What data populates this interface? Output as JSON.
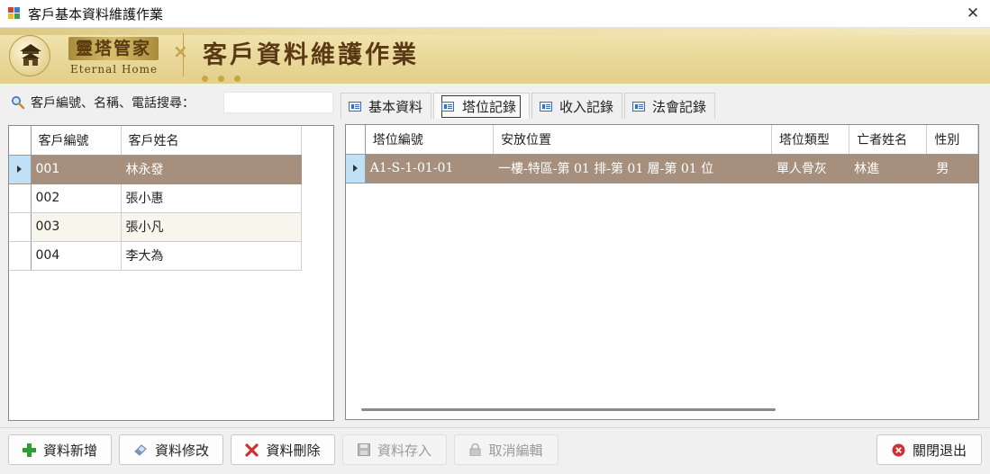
{
  "window": {
    "title": "客戶基本資料維護作業",
    "close_glyph": "✕"
  },
  "banner": {
    "logo_cn": "靈塔管家",
    "logo_en": "Eternal Home",
    "heading": "客戶資料維護作業",
    "cross": "×"
  },
  "search": {
    "label": "客戶編號、名稱、電話搜尋：",
    "value": ""
  },
  "customers": {
    "columns": [
      "客戶編號",
      "客戶姓名"
    ],
    "rows": [
      [
        "001",
        "林永發"
      ],
      [
        "002",
        "張小惠"
      ],
      [
        "003",
        "張小凡"
      ],
      [
        "004",
        "李大為"
      ]
    ],
    "selected_index": 0
  },
  "tabs": [
    {
      "label": "基本資料",
      "active": false
    },
    {
      "label": "塔位記錄",
      "active": true
    },
    {
      "label": "收入記錄",
      "active": false
    },
    {
      "label": "法會記錄",
      "active": false
    }
  ],
  "tower_records": {
    "columns": [
      "塔位編號",
      "安放位置",
      "塔位類型",
      "亡者姓名",
      "性別"
    ],
    "rows": [
      [
        "A1-S-1-01-01",
        "一樓-特區-第 01 排-第 01 層-第 01 位",
        "單人骨灰",
        "林進",
        "男"
      ]
    ],
    "selected_index": 0
  },
  "buttons": {
    "add": "資料新增",
    "edit": "資料修改",
    "delete": "資料刪除",
    "save": "資料存入",
    "cancel": "取消編輯",
    "close": "關閉退出"
  },
  "icons": {
    "add": "plus-icon",
    "edit": "eraser-icon",
    "delete": "x-icon",
    "save": "floppy-icon",
    "cancel": "lock-icon",
    "close": "close-circle-icon"
  },
  "colors": {
    "selected_row": "#a6907d",
    "row_header_selected": "#bfe0f5",
    "banner": "#e9d89a",
    "add_icon": "#2e9e32",
    "delete_icon": "#d23030",
    "close_icon": "#d23030"
  }
}
